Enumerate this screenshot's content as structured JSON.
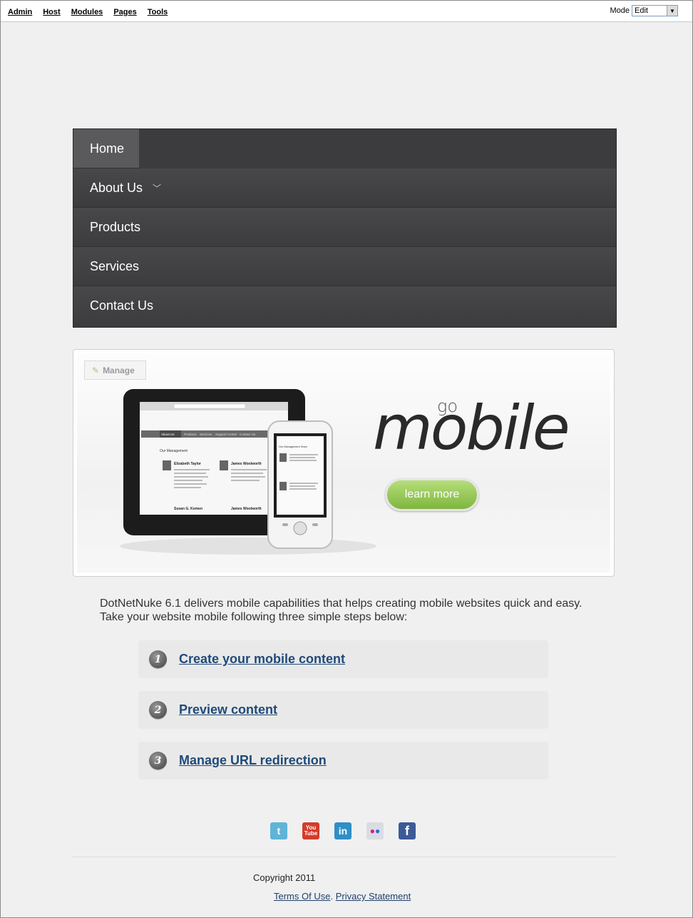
{
  "admin_bar": {
    "menu": [
      "Admin",
      "Host",
      "Modules",
      "Pages",
      "Tools"
    ],
    "mode_label": "Mode",
    "mode_value": "Edit"
  },
  "nav": {
    "items": [
      {
        "label": "Home",
        "active": true
      },
      {
        "label": "About Us",
        "has_submenu": true
      },
      {
        "label": "Products"
      },
      {
        "label": "Services"
      },
      {
        "label": "Contact Us"
      }
    ]
  },
  "banner": {
    "manage_label": "Manage",
    "go_text": "go",
    "mobile_text": "mobile",
    "learn_more": "learn more",
    "tablet_nav": [
      "About Us",
      "Products",
      "Services",
      "Support Center",
      "Contact Us"
    ],
    "tablet_heading": "Our Management",
    "tablet_people": [
      "Elizabeth Taylor",
      "James Woolworth",
      "Susan G. Komen",
      "James Woolworth"
    ],
    "phone_heading": "Our Management Team"
  },
  "intro": {
    "line1": "DotNetNuke 6.1 delivers mobile capabilities that helps creating mobile websites quick and easy.",
    "line2": "Take your website mobile following three simple steps below:"
  },
  "steps": [
    {
      "number": "1",
      "label": "Create your mobile content"
    },
    {
      "number": "2",
      "label": "Preview content"
    },
    {
      "number": "3",
      "label": "Manage URL redirection"
    }
  ],
  "social": [
    {
      "icon": "twitter-icon",
      "glyph": "t",
      "color": "#5fb4d8"
    },
    {
      "icon": "youtube-icon",
      "glyph": "You Tube",
      "color": "#d33c2a"
    },
    {
      "icon": "linkedin-icon",
      "glyph": "in",
      "color": "#2f8fc6"
    },
    {
      "icon": "flickr-icon",
      "glyph": "••",
      "color": "#d9dde3"
    },
    {
      "icon": "facebook-icon",
      "glyph": "f",
      "color": "#3b5b98"
    }
  ],
  "footer": {
    "copyright": "Copyright 2011",
    "terms": "Terms Of Use",
    "separator": ".",
    "privacy": "Privacy Statement"
  }
}
